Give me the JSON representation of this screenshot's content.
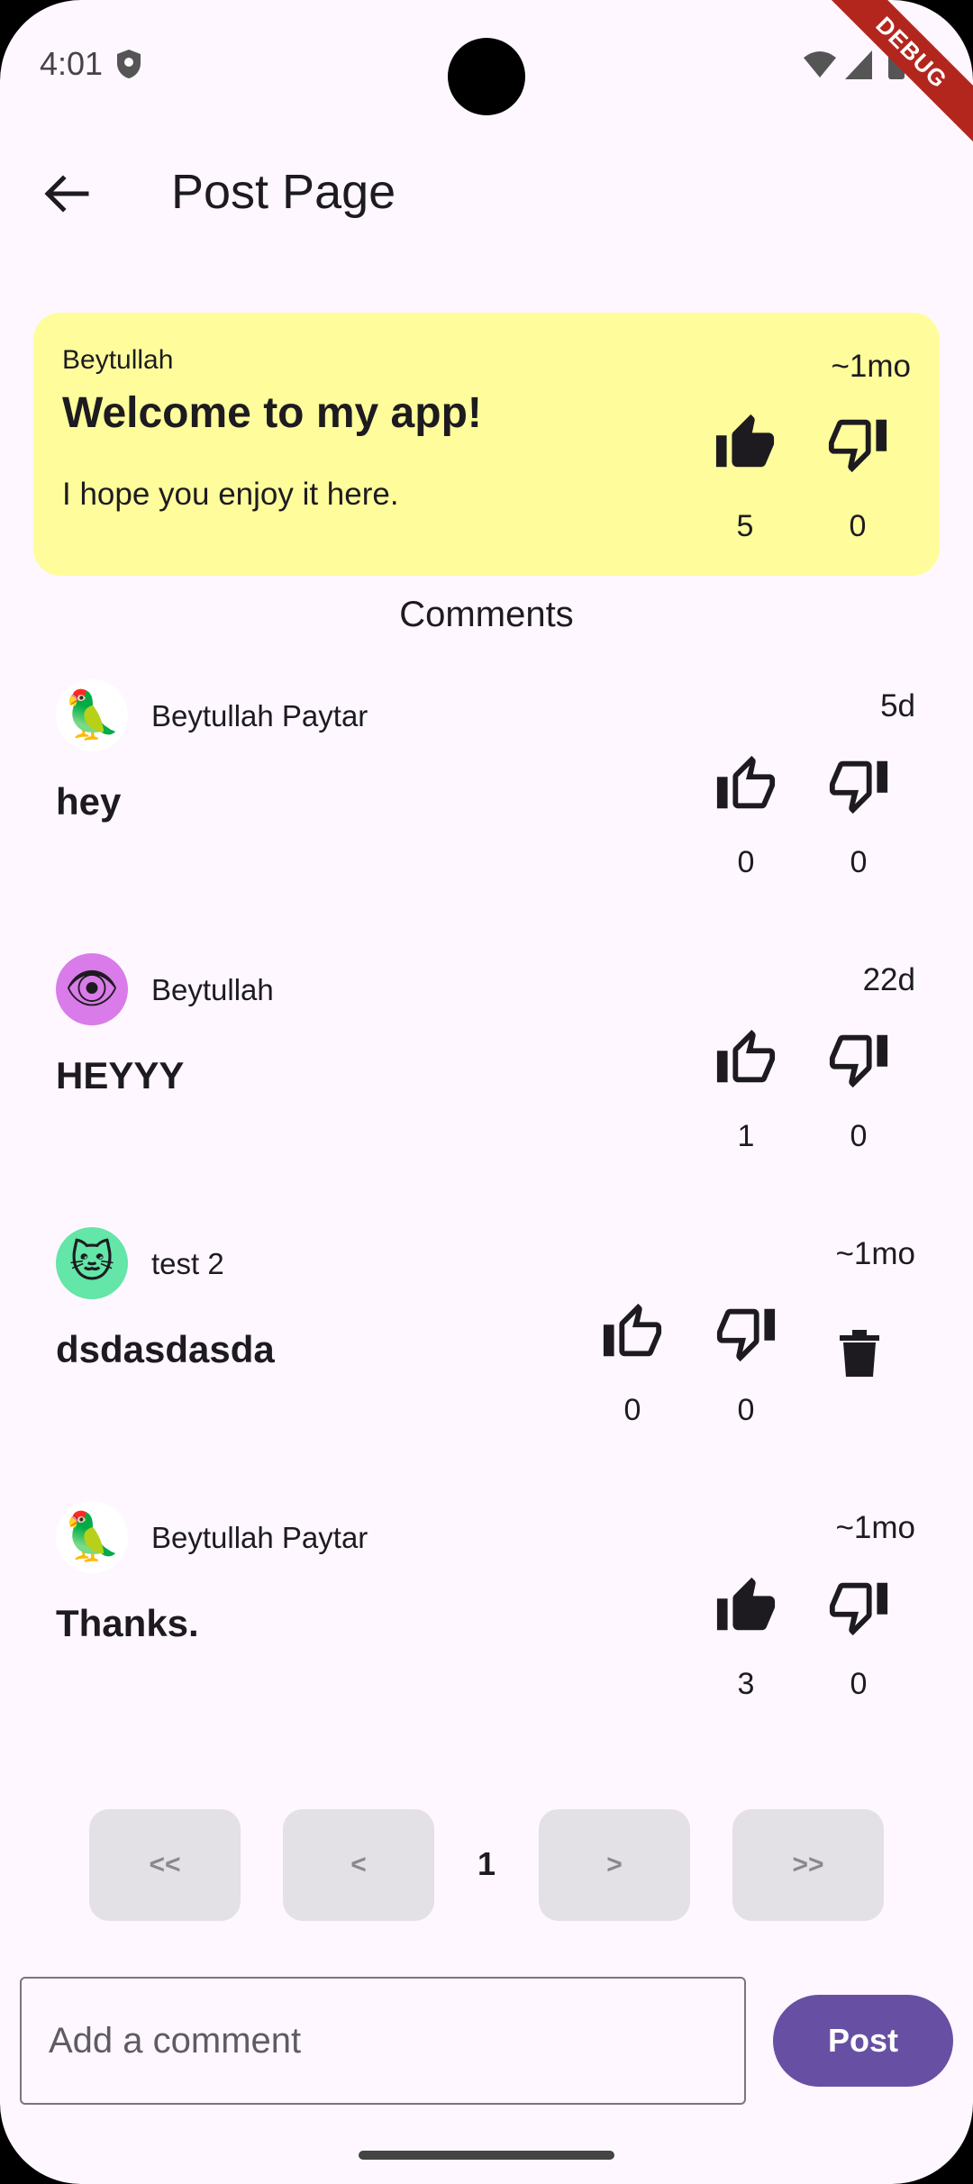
{
  "status_bar": {
    "time": "4:01",
    "debug_label": "DEBUG"
  },
  "app_bar": {
    "title": "Post Page"
  },
  "post": {
    "author": "Beytullah",
    "title": "Welcome to my app!",
    "body": "I hope you enjoy it here.",
    "time": "~1mo",
    "likes": "5",
    "dislikes": "0"
  },
  "comments_header": "Comments",
  "comments": [
    {
      "author": "Beytullah Paytar",
      "time": "5d",
      "text": "hey",
      "likes": "0",
      "dislikes": "0",
      "avatar_emoji": "🦜",
      "liked": false
    },
    {
      "author": "Beytullah",
      "time": "22d",
      "text": "HEYYY",
      "likes": "1",
      "dislikes": "0",
      "avatar_emoji": "👁",
      "liked": false
    },
    {
      "author": "test 2",
      "time": "~1mo",
      "text": "dsdasdasda",
      "likes": "0",
      "dislikes": "0",
      "avatar_emoji": "🐱",
      "liked": false
    },
    {
      "author": "Beytullah Paytar",
      "time": "~1mo",
      "text": "Thanks.",
      "likes": "3",
      "dislikes": "0",
      "avatar_emoji": "🦜",
      "liked": true
    }
  ],
  "pagination": {
    "first": "<<",
    "prev": "<",
    "current": "1",
    "next": ">",
    "last": ">>"
  },
  "composer": {
    "placeholder": "Add a comment",
    "post_label": "Post"
  },
  "colors": {
    "background": "#fef7ff",
    "post_card": "#fffd9b",
    "accent": "#6750a4"
  }
}
